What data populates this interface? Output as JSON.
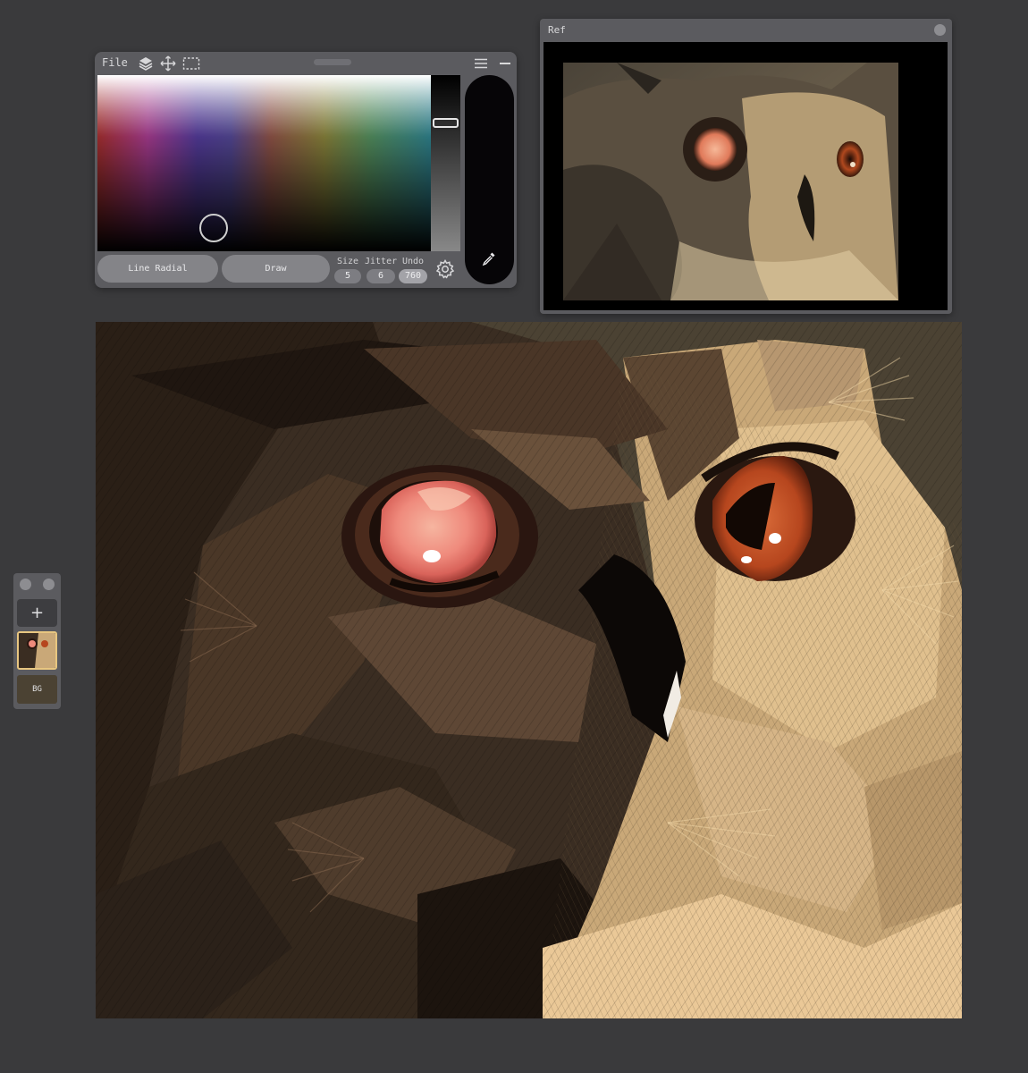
{
  "toolbar": {
    "file_label": "File",
    "icons": [
      "layers-icon",
      "move-icon",
      "selection-icon",
      "hamburger-menu-icon",
      "minimize-icon"
    ]
  },
  "brush": {
    "type_label": "Line Radial",
    "mode_label": "Draw",
    "params": [
      {
        "label": "Size",
        "value": "5"
      },
      {
        "label": "Jitter",
        "value": "6"
      },
      {
        "label": "Undo",
        "value": "760"
      }
    ],
    "current_color": "#060507"
  },
  "reference": {
    "title": "Ref"
  },
  "layers": {
    "add_label": "+",
    "bg_label": "BG",
    "accent": "#e8c680"
  },
  "colors": {
    "workspace": "#3a3a3c",
    "panel": "#5b5b5f",
    "canvas_bg": "#4b4233"
  }
}
